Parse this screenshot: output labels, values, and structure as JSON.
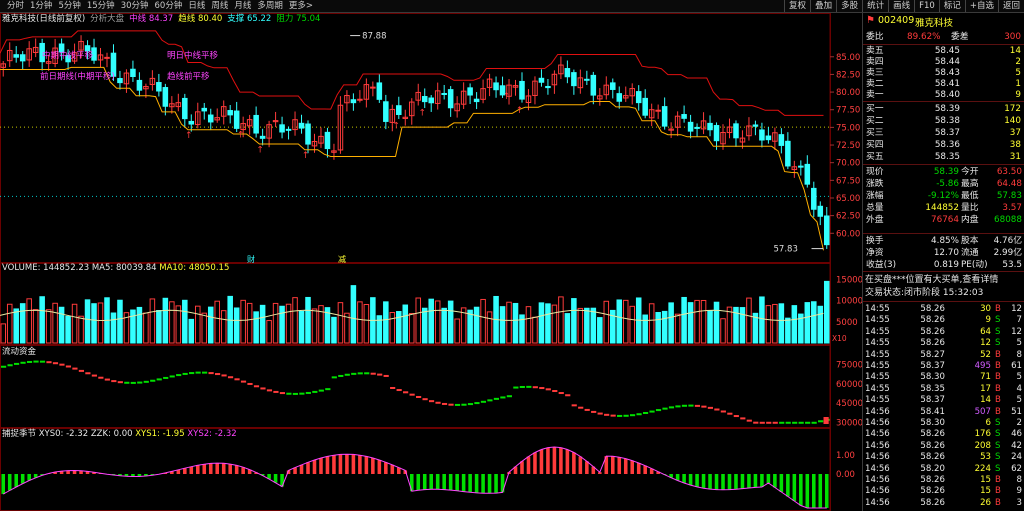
{
  "periods": [
    "分时",
    "1分钟",
    "5分钟",
    "15分钟",
    "30分钟",
    "60分钟",
    "日线",
    "周线",
    "月线",
    "多周期",
    "更多>"
  ],
  "toolbar": [
    "复权",
    "叠加",
    "多股",
    "统计",
    "画线",
    "F10",
    "标记",
    "+自选",
    "返回"
  ],
  "main": {
    "title": "雅克科技(日线前复权)",
    "indicator_name": "分析大盘",
    "indicators": [
      {
        "label": "中线",
        "value": "84.37",
        "color": "#ff44ff"
      },
      {
        "label": "趋线",
        "value": "80.40",
        "color": "#ffff33"
      },
      {
        "label": "支撑",
        "value": "65.22",
        "color": "#33ffff"
      },
      {
        "label": "阻力",
        "value": "75.04",
        "color": "#00d800"
      }
    ],
    "overlay_texts": [
      "中期中线平移",
      "前日期线(中期平移)",
      "明日中线平移",
      "趋线前平移"
    ],
    "high_label": "87.88",
    "low_label": "57.83",
    "price_axis": [
      "85.00",
      "82.50",
      "80.00",
      "77.50",
      "75.00",
      "72.50",
      "70.00",
      "67.50",
      "65.00",
      "62.50",
      "60.00"
    ],
    "event_markers": [
      "财",
      "减"
    ]
  },
  "volume": {
    "label": "VOLUME",
    "value": "144852.23",
    "ma5_label": "MA5",
    "ma5": "80039.84",
    "ma10_label": "MA10",
    "ma10": "48050.15",
    "axis": [
      "15000",
      "10000",
      "5000"
    ],
    "unit": "X10"
  },
  "fund": {
    "label": "流动资金",
    "axis": [
      "75000",
      "60000",
      "45000",
      "30000"
    ]
  },
  "xys": {
    "label": "捕捉季节",
    "xys0": "XYS0: -2.32",
    "zz": "ZZK: 0.00",
    "xys1": "XYS1: -1.95",
    "xys2": "XYS2: -2.32",
    "axis": [
      "1.00",
      "0.00"
    ]
  },
  "stock": {
    "code": "002409",
    "name": "雅克科技"
  },
  "ratio": {
    "label1": "委比",
    "value1": "89.62%",
    "label2": "委差",
    "value2": "300"
  },
  "asks": [
    {
      "label": "卖五",
      "price": "58.45",
      "vol": "14"
    },
    {
      "label": "卖四",
      "price": "58.44",
      "vol": "2"
    },
    {
      "label": "卖三",
      "price": "58.43",
      "vol": "5"
    },
    {
      "label": "卖二",
      "price": "58.41",
      "vol": "1"
    },
    {
      "label": "卖一",
      "price": "58.40",
      "vol": "9"
    }
  ],
  "bids": [
    {
      "label": "买一",
      "price": "58.39",
      "vol": "172"
    },
    {
      "label": "买二",
      "price": "58.38",
      "vol": "140"
    },
    {
      "label": "买三",
      "price": "58.37",
      "vol": "37"
    },
    {
      "label": "买四",
      "price": "58.36",
      "vol": "38"
    },
    {
      "label": "买五",
      "price": "58.35",
      "vol": "31"
    }
  ],
  "quotes": [
    {
      "l1": "现价",
      "v1": "58.39",
      "l2": "今开",
      "v2": "63.50",
      "c1": "#00d800",
      "c2": "#ff3b3b"
    },
    {
      "l1": "涨跌",
      "v1": "-5.86",
      "l2": "最高",
      "v2": "64.48",
      "c1": "#00d800",
      "c2": "#ff3b3b"
    },
    {
      "l1": "涨幅",
      "v1": "-9.12%",
      "l2": "最低",
      "v2": "57.83",
      "c1": "#00d800",
      "c2": "#00d800"
    },
    {
      "l1": "总量",
      "v1": "144852",
      "l2": "量比",
      "v2": "3.57",
      "c1": "#ffff33",
      "c2": "#ff3b3b"
    },
    {
      "l1": "外盘",
      "v1": "76764",
      "l2": "内盘",
      "v2": "68088",
      "c1": "#ff3b3b",
      "c2": "#00d800"
    }
  ],
  "stats": [
    {
      "l1": "换手",
      "v1": "4.85%",
      "l2": "股本",
      "v2": "4.76亿"
    },
    {
      "l1": "净资",
      "v1": "12.70",
      "l2": "流通",
      "v2": "2.99亿"
    },
    {
      "l1": "收益(3)",
      "v1": "0.819",
      "l2": "PE(动)",
      "v2": "53.5"
    }
  ],
  "notice": "在买盘***位置有大买单,查看详情",
  "trade_status": "交易状态:闭市阶段 15:32:03",
  "ticks": [
    {
      "t": "14:55",
      "p": "58.26",
      "v": "30",
      "d": "B",
      "n": "12"
    },
    {
      "t": "14:55",
      "p": "58.26",
      "v": "9",
      "d": "S",
      "n": "7"
    },
    {
      "t": "14:55",
      "p": "58.26",
      "v": "64",
      "d": "S",
      "n": "12"
    },
    {
      "t": "14:55",
      "p": "58.26",
      "v": "12",
      "d": "S",
      "n": "5"
    },
    {
      "t": "14:55",
      "p": "58.27",
      "v": "52",
      "d": "B",
      "n": "8"
    },
    {
      "t": "14:55",
      "p": "58.37",
      "v": "495",
      "d": "B",
      "n": "61"
    },
    {
      "t": "14:55",
      "p": "58.30",
      "v": "71",
      "d": "B",
      "n": "5"
    },
    {
      "t": "14:55",
      "p": "58.35",
      "v": "17",
      "d": "B",
      "n": "4"
    },
    {
      "t": "14:55",
      "p": "58.37",
      "v": "14",
      "d": "B",
      "n": "5"
    },
    {
      "t": "14:56",
      "p": "58.41",
      "v": "507",
      "d": "B",
      "n": "51"
    },
    {
      "t": "14:56",
      "p": "58.30",
      "v": "6",
      "d": "S",
      "n": "2"
    },
    {
      "t": "14:56",
      "p": "58.26",
      "v": "176",
      "d": "S",
      "n": "46"
    },
    {
      "t": "14:56",
      "p": "58.26",
      "v": "208",
      "d": "S",
      "n": "42"
    },
    {
      "t": "14:56",
      "p": "58.26",
      "v": "53",
      "d": "S",
      "n": "24"
    },
    {
      "t": "14:56",
      "p": "58.20",
      "v": "224",
      "d": "S",
      "n": "62"
    },
    {
      "t": "14:56",
      "p": "58.26",
      "v": "15",
      "d": "B",
      "n": "8"
    },
    {
      "t": "14:56",
      "p": "58.26",
      "v": "15",
      "d": "B",
      "n": "9"
    },
    {
      "t": "14:56",
      "p": "58.26",
      "v": "26",
      "d": "B",
      "n": "3"
    }
  ],
  "colors": {
    "up": "#ff3b3b",
    "down": "#33ffff",
    "grid": "#6a0000"
  }
}
